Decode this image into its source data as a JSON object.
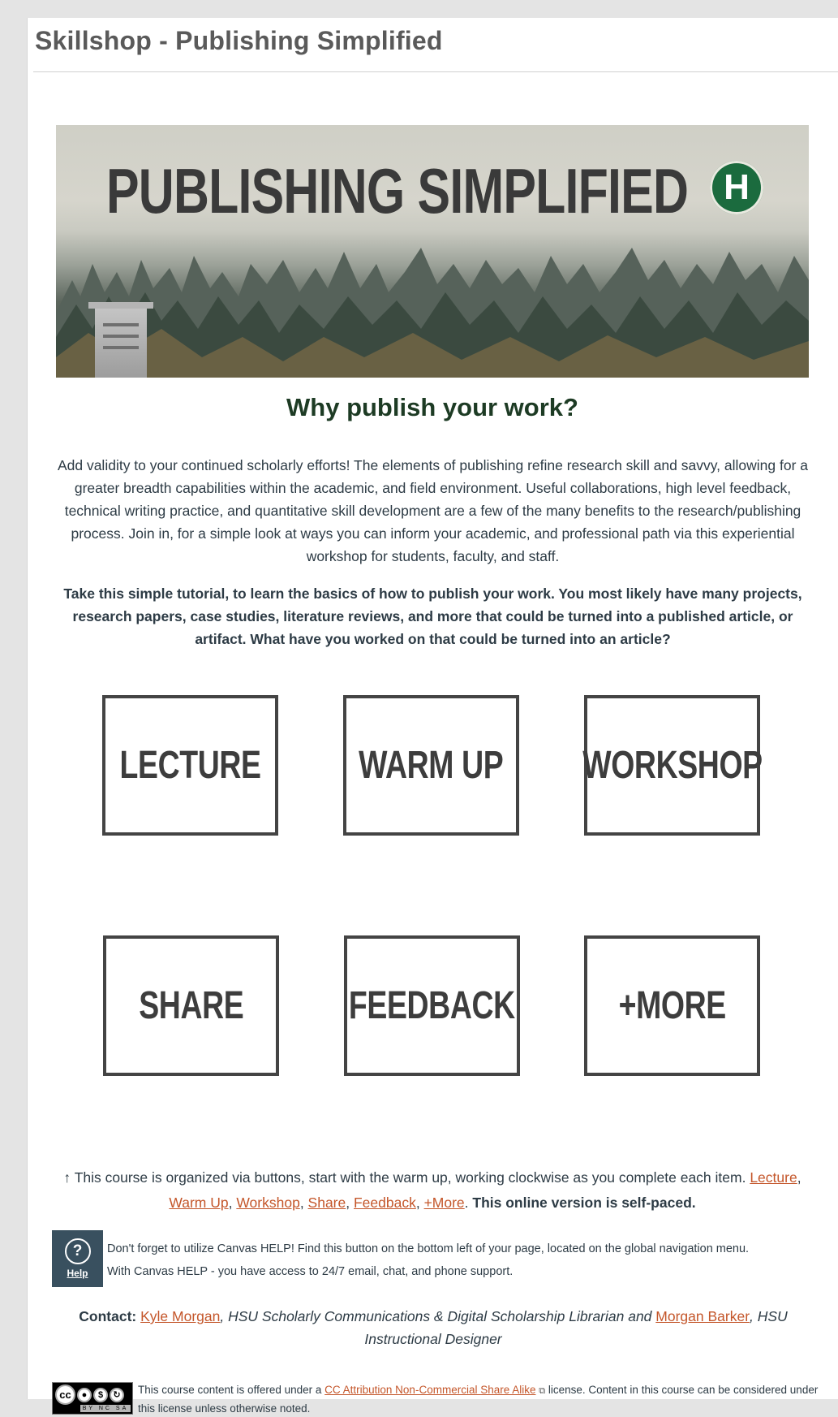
{
  "page": {
    "title": "Skillshop - Publishing Simplified"
  },
  "banner": {
    "text": "PUBLISHING SIMPLIFIED",
    "logo_letter": "H"
  },
  "intro": {
    "heading": "Why publish your work?",
    "paragraph": "Add validity to your continued scholarly efforts! The elements of publishing refine research skill and savvy, allowing for a greater breadth capabilities within the academic, and field environment. Useful collaborations, high level feedback, technical writing practice, and quantitative skill development are a few of the many benefits to the research/publishing process. Join in, for a simple look at ways you can inform your academic, and professional path via this experiential workshop for students, faculty, and staff.",
    "bold_paragraph": "Take this simple tutorial, to learn the basics of how to publish your work. You most likely have many projects, research papers, case studies, literature reviews, and more that could be turned into a published article, or artifact. What have you worked on that could be turned into an article?"
  },
  "tiles": [
    {
      "label": "LECTURE"
    },
    {
      "label": "WARM UP"
    },
    {
      "label": "WORKSHOP"
    },
    {
      "label": "SHARE"
    },
    {
      "label": "FEEDBACK"
    },
    {
      "label": "+MORE"
    }
  ],
  "organization": {
    "arrow": "↑",
    "text_before": " This course is organized via buttons, start with the warm up, working clockwise as you complete each item. ",
    "links": [
      "Lecture",
      "Warm Up",
      "Workshop",
      "Share",
      "Feedback",
      "+More"
    ],
    "separator": ", ",
    "period": ". ",
    "bold_text": "This online version is self-paced."
  },
  "help": {
    "icon_glyph": "?",
    "label": "Help",
    "line1": "Don't forget to utilize Canvas HELP! Find this button on the bottom left of your page, located on the global navigation menu.",
    "line2": "With Canvas HELP - you have access to 24/7 email, chat, and phone support."
  },
  "contact": {
    "label": "Contact:",
    "name1": "Kyle Morgan",
    "role1": ", HSU Scholarly Communications & Digital Scholarship Librarian and ",
    "name2": "Morgan Barker",
    "role2": ", HSU Instructional Designer"
  },
  "license": {
    "badge_cc": "cc",
    "badge_band": "BY NC SA",
    "text_before": "This course content is offered under a ",
    "link": "CC Attribution Non-Commercial Share Alike",
    "text_after": " license. Content in this course can be considered under this license unless otherwise noted."
  }
}
